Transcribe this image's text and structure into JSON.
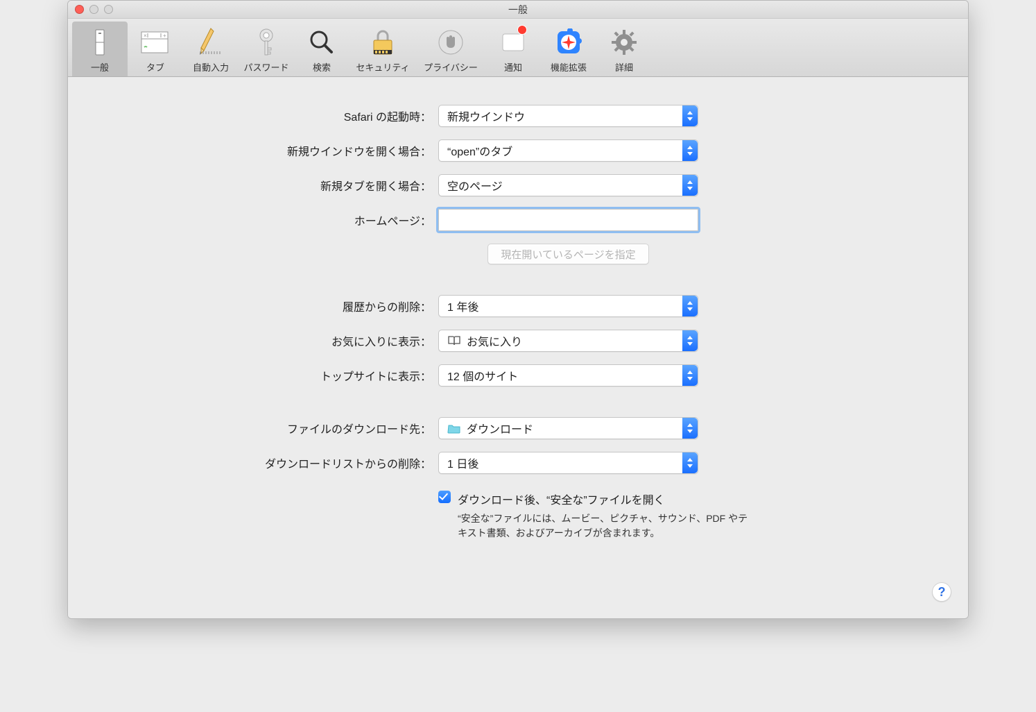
{
  "window": {
    "title": "一般"
  },
  "toolbar": {
    "items": [
      {
        "label": "一般",
        "name": "general",
        "selected": true
      },
      {
        "label": "タブ",
        "name": "tabs",
        "selected": false
      },
      {
        "label": "自動入力",
        "name": "autofill",
        "selected": false
      },
      {
        "label": "パスワード",
        "name": "passwords",
        "selected": false
      },
      {
        "label": "検索",
        "name": "search",
        "selected": false
      },
      {
        "label": "セキュリティ",
        "name": "security",
        "selected": false
      },
      {
        "label": "プライバシー",
        "name": "privacy",
        "selected": false
      },
      {
        "label": "通知",
        "name": "notifications",
        "selected": false
      },
      {
        "label": "機能拡張",
        "name": "extensions",
        "selected": false
      },
      {
        "label": "詳細",
        "name": "advanced",
        "selected": false
      }
    ]
  },
  "settings": {
    "on_launch": {
      "label": "Safari の起動時：",
      "value": "新規ウインドウ"
    },
    "new_window": {
      "label": "新規ウインドウを開く場合：",
      "value": "“open”のタブ"
    },
    "new_tab": {
      "label": "新規タブを開く場合：",
      "value": "空のページ"
    },
    "homepage": {
      "label": "ホームページ：",
      "value": ""
    },
    "set_homepage_btn": {
      "label": "現在開いているページを指定"
    },
    "history_remove": {
      "label": "履歴からの削除：",
      "value": "1 年後"
    },
    "favorites_show": {
      "label": "お気に入りに表示：",
      "value": "お気に入り"
    },
    "topsites_show": {
      "label": "トップサイトに表示：",
      "value": "12 個のサイト"
    },
    "download_dest": {
      "label": "ファイルのダウンロード先：",
      "value": "ダウンロード"
    },
    "download_remove": {
      "label": "ダウンロードリストからの削除：",
      "value": "1 日後"
    },
    "open_safe": {
      "label": "ダウンロード後、“安全な”ファイルを開く",
      "help": "“安全な”ファイルには、ムービー、ピクチャ、サウンド、PDF やテキスト書類、およびアーカイブが含まれます。",
      "checked": true
    }
  },
  "help_button": "?",
  "icons": {
    "bookmark": "book-open-icon",
    "folder": "folder-icon"
  }
}
